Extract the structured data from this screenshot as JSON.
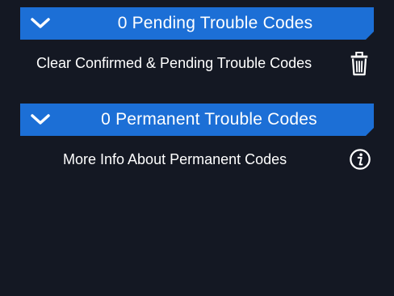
{
  "pending": {
    "header_title": "0 Pending Trouble Codes",
    "action_label": "Clear Confirmed & Pending Trouble Codes",
    "action_icon": "trash-icon"
  },
  "permanent": {
    "header_title": "0 Permanent Trouble Codes",
    "action_label": "More Info About Permanent Codes",
    "action_icon": "info-icon"
  },
  "colors": {
    "background": "#141823",
    "header": "#1c6fd6",
    "text": "#ffffff"
  }
}
